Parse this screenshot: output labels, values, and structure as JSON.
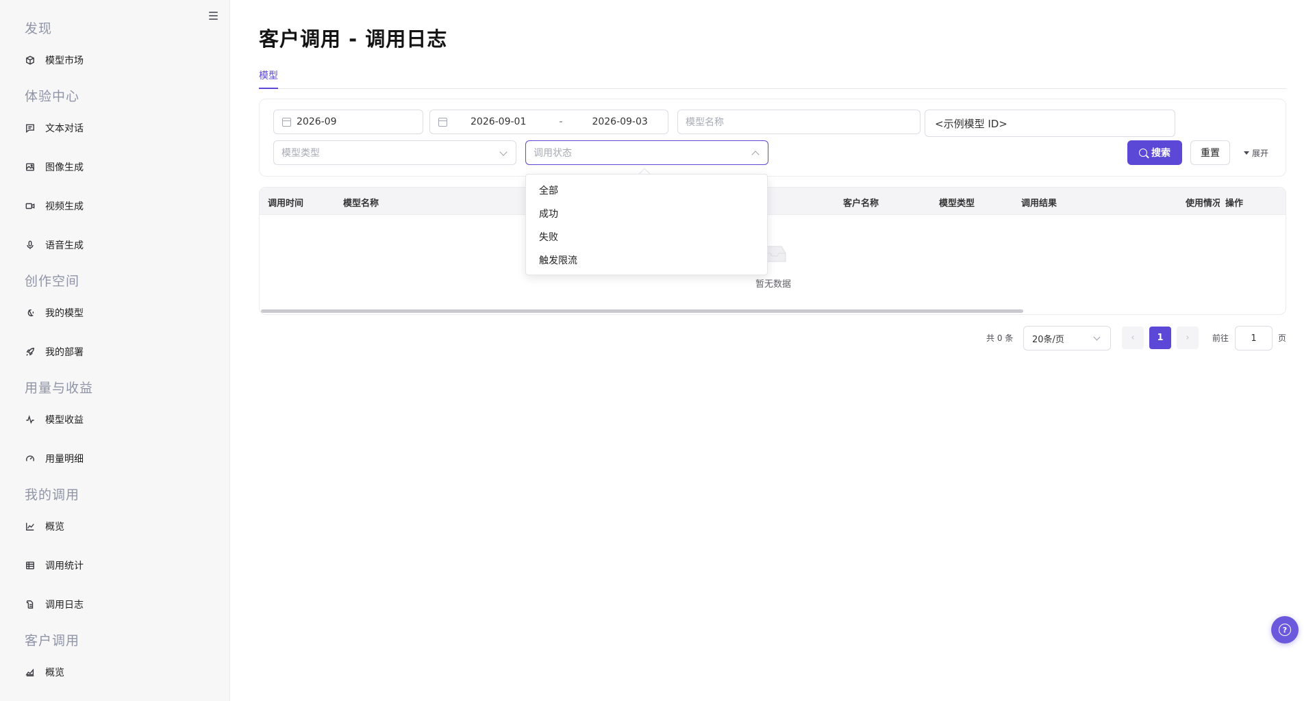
{
  "sidebar": {
    "groups": {
      "discover": "发现",
      "experience": "体验中心",
      "creation": "创作空间",
      "usage": "用量与收益",
      "my_calls": "我的调用",
      "customer_calls": "客户调用"
    },
    "items": {
      "model_market": "模型市场",
      "text_chat": "文本对话",
      "image_gen": "图像生成",
      "video_gen": "视频生成",
      "voice_gen": "语音生成",
      "my_models": "我的模型",
      "my_deploy": "我的部署",
      "model_revenue": "模型收益",
      "usage_detail": "用量明细",
      "overview": "概览",
      "call_stats": "调用统计",
      "call_log": "调用日志",
      "customer_overview": "概览"
    }
  },
  "page": {
    "title": "客户调用 - 调用日志",
    "tab": "模型"
  },
  "filters": {
    "month": "2026-09",
    "date_start": "2026-09-01",
    "date_sep": "-",
    "date_end": "2026-09-03",
    "model_name_placeholder": "模型名称",
    "model_id_value": "<示例模型 ID>",
    "model_type_placeholder": "模型类型",
    "call_status_placeholder": "调用状态",
    "search_label": "搜索",
    "reset_label": "重置",
    "expand_label": "展开"
  },
  "status_dropdown": {
    "options": [
      "全部",
      "成功",
      "失败",
      "触发限流"
    ]
  },
  "table": {
    "columns": [
      "调用时间",
      "模型名称",
      "客户名称",
      "模型类型",
      "调用结果",
      "使用情况",
      "操作"
    ],
    "empty_text": "暂无数据"
  },
  "pagination": {
    "total_text": "共 0 条",
    "page_size": "20条/页",
    "current_page": "1",
    "goto_label": "前往",
    "goto_value": "1",
    "page_suffix": "页"
  },
  "colors": {
    "accent": "#5b48d6",
    "sidebar_bg": "#f7f7f8"
  }
}
